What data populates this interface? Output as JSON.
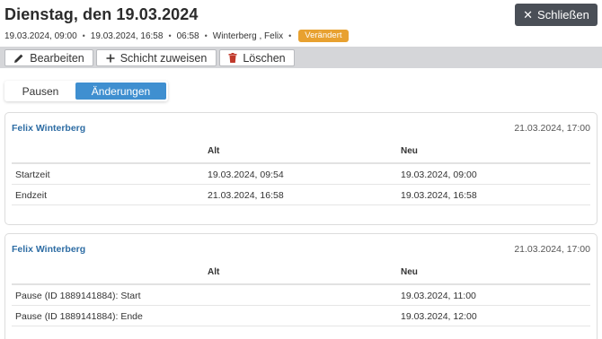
{
  "header": {
    "title": "Dienstag, den 19.03.2024",
    "close_label": "Schließen",
    "meta": {
      "start": "19.03.2024, 09:00",
      "end": "19.03.2024, 16:58",
      "duration": "06:58",
      "person": "Winterberg , Felix",
      "separator": "•",
      "status_badge": "Verändert"
    }
  },
  "toolbar": {
    "edit_label": "Bearbeiten",
    "assign_label": "Schicht zuweisen",
    "delete_label": "Löschen"
  },
  "tabs": [
    {
      "label": "Pausen",
      "active": false
    },
    {
      "label": "Änderungen",
      "active": true
    }
  ],
  "changes": [
    {
      "user": "Felix Winterberg",
      "date": "21.03.2024, 17:00",
      "col_alt": "Alt",
      "col_neu": "Neu",
      "rows": [
        {
          "label": "Startzeit",
          "alt": "19.03.2024, 09:54",
          "neu": "19.03.2024, 09:00"
        },
        {
          "label": "Endzeit",
          "alt": "21.03.2024, 16:58",
          "neu": "19.03.2024, 16:58"
        }
      ]
    },
    {
      "user": "Felix Winterberg",
      "date": "21.03.2024, 17:00",
      "col_alt": "Alt",
      "col_neu": "Neu",
      "rows": [
        {
          "label": "Pause (ID 1889141884): Start",
          "alt": "",
          "neu": "19.03.2024, 11:00"
        },
        {
          "label": "Pause (ID 1889141884): Ende",
          "alt": "",
          "neu": "19.03.2024, 12:00"
        }
      ]
    }
  ],
  "colors": {
    "accent_blue": "#3f8fd0",
    "user_link": "#2e6da4",
    "badge_orange": "#e8a130",
    "close_button": "#4a4f57",
    "toolbar_bg": "#d5d6d9",
    "delete_icon": "#c0392b"
  },
  "icons": {
    "close": "close-icon",
    "edit": "pencil-icon",
    "assign": "plus-icon",
    "delete": "trash-icon"
  }
}
